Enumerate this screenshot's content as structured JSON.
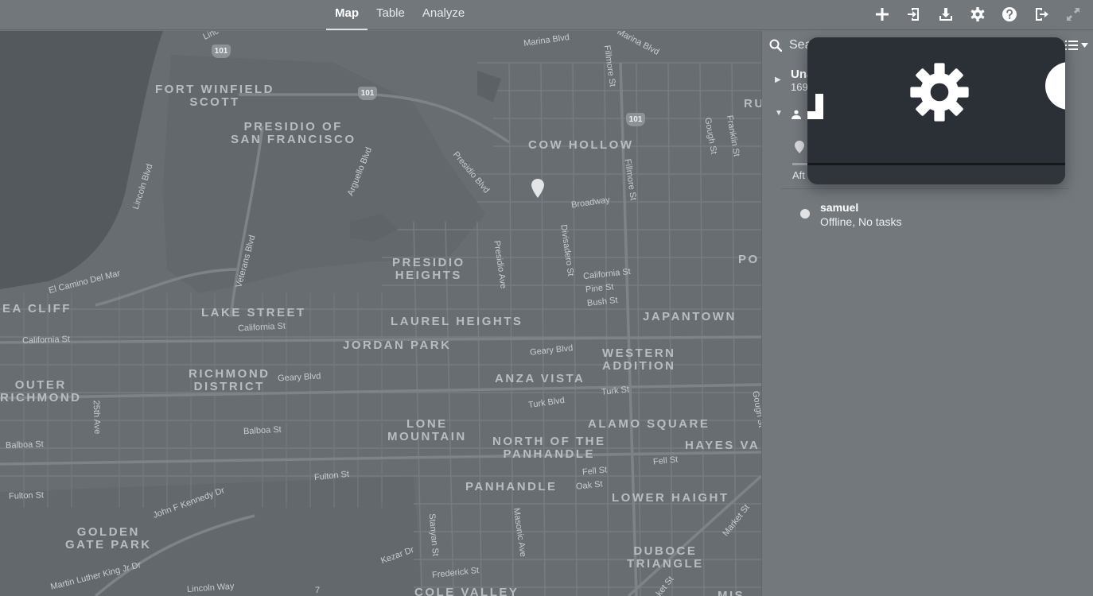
{
  "nav": {
    "tabs": [
      {
        "label": "Map",
        "active": true
      },
      {
        "label": "Table",
        "active": false
      },
      {
        "label": "Analyze",
        "active": false
      }
    ],
    "tools": [
      "plus-icon",
      "import-icon",
      "download-icon",
      "gear-icon",
      "help-icon",
      "logout-icon",
      "expand-icon"
    ]
  },
  "map": {
    "neighborhoods": {
      "fort_winfield": "FORT WINFIELD\nSCOTT",
      "presidio_sf": "PRESIDIO OF\nSAN FRANCISCO",
      "cow_hollow": "COW HOLLOW",
      "presidio_heights": "PRESIDIO\nHEIGHTS",
      "sea_cliff": "EA CLIFF",
      "lake_street": "LAKE STREET",
      "laurel_heights": "LAUREL HEIGHTS",
      "jordan_park": "JORDAN PARK",
      "japantown": "JAPANTOWN",
      "western_addition": "WESTERN\nADDITION",
      "anza_vista": "ANZA VISTA",
      "richmond_district": "RICHMOND\nDISTRICT",
      "outer_richmond": "OUTER\nRICHMOND",
      "lone_mountain": "LONE\nMOUNTAIN",
      "alamo_square": "ALAMO SQUARE",
      "north_panhandle": "NORTH OF THE\nPANHANDLE",
      "hayes": "HAYES VA",
      "panhandle": "PANHANDLE",
      "lower_haight": "LOWER HAIGHT",
      "golden_gate_park": "GOLDEN\nGATE PARK",
      "duboce_triangle": "DUBOCE\nTRIANGLE",
      "cole_valley": "COLE VALLEY",
      "ru": "RU",
      "po": "PO",
      "mis": "MIS"
    },
    "streets": {
      "marina_blvd": "Marina Blvd",
      "marina_blvd2": "Marina Blvd",
      "lincoln_blvd_top": "Linc",
      "fillmore_top": "Fillmore St",
      "gough_st": "Gough St",
      "franklin_st": "Franklin St",
      "lincoln_blvd": "Lincoln Blvd",
      "arguello_blvd": "Arguello Blvd",
      "presidio_blvd": "Presidio Blvd",
      "fillmore_st": "Fillmore St",
      "broadway": "Broadway",
      "veterans_blvd": "Veterans Blvd",
      "el_camino": "El Camino Del Mar",
      "presidio_ave": "Presidio Ave",
      "divisadero_st": "Divisadero St",
      "california_st_e": "California St",
      "pine_st": "Pine St",
      "bush_st": "Bush St",
      "california_st_m": "California St",
      "california_st_w": "California St",
      "geary_blvd_e": "Geary Blvd",
      "geary_blvd_w": "Geary Blvd",
      "turk_st": "Turk St",
      "turk_blvd": "Turk Blvd",
      "ave_25th": "25th Ave",
      "balboa_st_e": "Balboa St",
      "balboa_st_w": "Balboa St",
      "fell_st_m": "Fell St",
      "fell_st_e": "Fell St",
      "oak_st": "Oak St",
      "fulton_st_e": "Fulton St",
      "fulton_st_w": "Fulton St",
      "jfk_dr": "John F Kennedy Dr",
      "stanyan_st": "Stanyan St",
      "masonic_ave": "Masonic Ave",
      "market_st": "Market St",
      "kezar_dr": "Kezar Dr",
      "frederick_st": "Frederick St",
      "mlk_dr": "Martin Luther King Jr Dr",
      "lincoln_way": "Lincoln Way",
      "gough_st_e": "Gough St",
      "market_st_b": "ket St",
      "seven": "7"
    },
    "shields": {
      "s1": "101",
      "s2": "101",
      "s3": "101"
    }
  },
  "side": {
    "search_placeholder": "Sea",
    "unassigned_title": "Una",
    "unassigned_count": "169",
    "task_time": "Aft",
    "driver": {
      "name": "samuel",
      "status": "Offline, No tasks"
    }
  },
  "colors": {
    "topbar": "#72777c",
    "map_bg": "#686d72",
    "panel_bg": "#73787d",
    "overlay_bg": "#2b3036"
  }
}
